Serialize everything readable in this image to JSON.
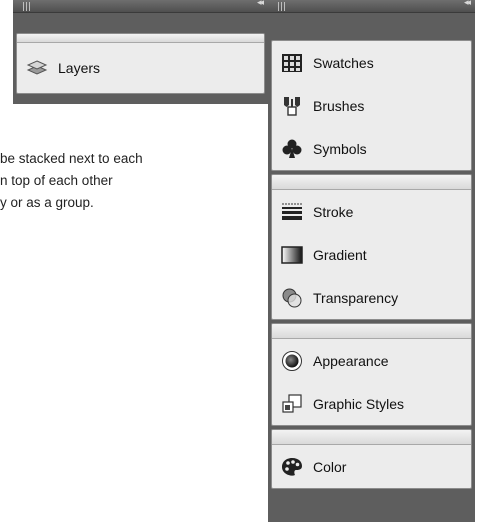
{
  "caption": {
    "line1": "be stacked next to each",
    "line2": "n top of each other",
    "line3": "y or as a group."
  },
  "collapse_glyph": "◂◂",
  "left_dock": {
    "items": [
      {
        "label": "Layers",
        "icon": "layers-icon"
      }
    ]
  },
  "right_dock": {
    "groups": [
      {
        "items": [
          {
            "label": "Swatches",
            "icon": "swatches-icon"
          },
          {
            "label": "Brushes",
            "icon": "brushes-icon"
          },
          {
            "label": "Symbols",
            "icon": "symbols-icon"
          }
        ]
      },
      {
        "items": [
          {
            "label": "Stroke",
            "icon": "stroke-icon"
          },
          {
            "label": "Gradient",
            "icon": "gradient-icon"
          },
          {
            "label": "Transparency",
            "icon": "transparency-icon"
          }
        ]
      },
      {
        "items": [
          {
            "label": "Appearance",
            "icon": "appearance-icon"
          },
          {
            "label": "Graphic Styles",
            "icon": "graphic-styles-icon"
          }
        ]
      },
      {
        "items": [
          {
            "label": "Color",
            "icon": "color-icon"
          }
        ]
      }
    ]
  }
}
